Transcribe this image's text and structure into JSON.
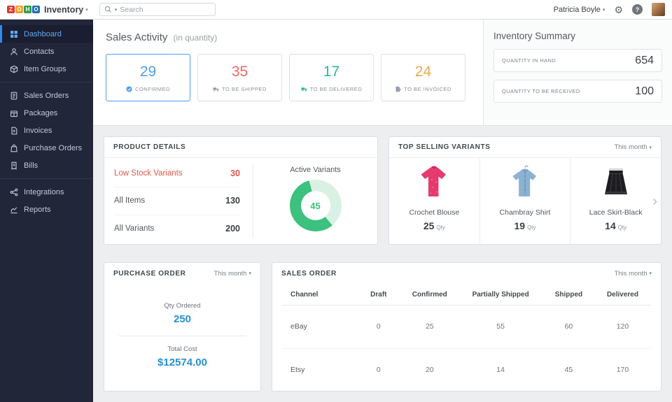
{
  "topbar": {
    "logo_letters": [
      {
        "ch": "Z",
        "color": "#e0392f"
      },
      {
        "ch": "O",
        "color": "#f0a32a"
      },
      {
        "ch": "H",
        "color": "#2f9e4f"
      },
      {
        "ch": "O",
        "color": "#2270b5"
      }
    ],
    "app_name": "Inventory",
    "search_placeholder": "Search",
    "user_name": "Patricia Boyle",
    "icons": [
      "search-icon",
      "gear-icon",
      "help-icon",
      "user-avatar"
    ]
  },
  "sidebar": {
    "items": [
      {
        "label": "Dashboard",
        "icon": "dashboard-icon",
        "active": true
      },
      {
        "label": "Contacts",
        "icon": "contacts-icon"
      },
      {
        "label": "Item Groups",
        "icon": "item-groups-icon"
      },
      {
        "label": "Sales Orders",
        "icon": "sales-orders-icon"
      },
      {
        "label": "Packages",
        "icon": "packages-icon"
      },
      {
        "label": "Invoices",
        "icon": "invoices-icon"
      },
      {
        "label": "Purchase Orders",
        "icon": "purchase-orders-icon"
      },
      {
        "label": "Bills",
        "icon": "bills-icon"
      },
      {
        "label": "Integrations",
        "icon": "integrations-icon"
      },
      {
        "label": "Reports",
        "icon": "reports-icon"
      }
    ]
  },
  "sales_activity": {
    "title": "Sales Activity",
    "subtitle": "(in quantity)",
    "cards": [
      {
        "value": "29",
        "label": "CONFIRMED",
        "color": "#4c9ef0",
        "icon": "check-circle-icon",
        "selected": true
      },
      {
        "value": "35",
        "label": "TO BE SHIPPED",
        "color": "#ec6a60",
        "icon": "truck-icon"
      },
      {
        "value": "17",
        "label": "TO BE DELIVERED",
        "color": "#2eb795",
        "icon": "delivery-truck-icon"
      },
      {
        "value": "24",
        "label": "TO BE INVOICED",
        "color": "#eaa94e",
        "icon": "invoice-icon"
      }
    ]
  },
  "inventory_summary": {
    "title": "Inventory Summary",
    "rows": [
      {
        "label": "QUANTITY IN HAND",
        "value": "654"
      },
      {
        "label": "QUANTITY TO BE RECEIVED",
        "value": "100"
      }
    ]
  },
  "product_details": {
    "title": "PRODUCT DETAILS",
    "rows": [
      {
        "label": "Low Stock Variants",
        "value": "30",
        "highlight": "#e2574c"
      },
      {
        "label": "All Items",
        "value": "130"
      },
      {
        "label": "All Variants",
        "value": "200"
      }
    ],
    "donut": {
      "label": "Active Variants",
      "value": "45",
      "percent": 57,
      "color": "#3cc17e",
      "track_color": "#d9f1e3"
    }
  },
  "top_selling": {
    "title": "TOP SELLING VARIANTS",
    "filter": "This month",
    "qty_unit": "Qty",
    "items": [
      {
        "name": "Crochet Blouse",
        "qty": "25",
        "image": "pink-blouse"
      },
      {
        "name": "Chambray Shirt",
        "qty": "19",
        "image": "blue-shirt"
      },
      {
        "name": "Lace Skirt-Black",
        "qty": "14",
        "image": "black-skirt"
      }
    ]
  },
  "purchase_order": {
    "title": "PURCHASE ORDER",
    "filter": "This month",
    "qty_label": "Qty Ordered",
    "qty_value": "250",
    "cost_label": "Total Cost",
    "cost_value": "$12574.00",
    "accent": "#2591d0"
  },
  "sales_order": {
    "title": "SALES ORDER",
    "filter": "This month",
    "columns": [
      "Channel",
      "Draft",
      "Confirmed",
      "Partially Shipped",
      "Shipped",
      "Delivered"
    ],
    "rows": [
      {
        "cells": [
          "eBay",
          "0",
          "25",
          "55",
          "60",
          "120"
        ]
      },
      {
        "cells": [
          "Etsy",
          "0",
          "20",
          "14",
          "45",
          "170"
        ]
      }
    ]
  }
}
